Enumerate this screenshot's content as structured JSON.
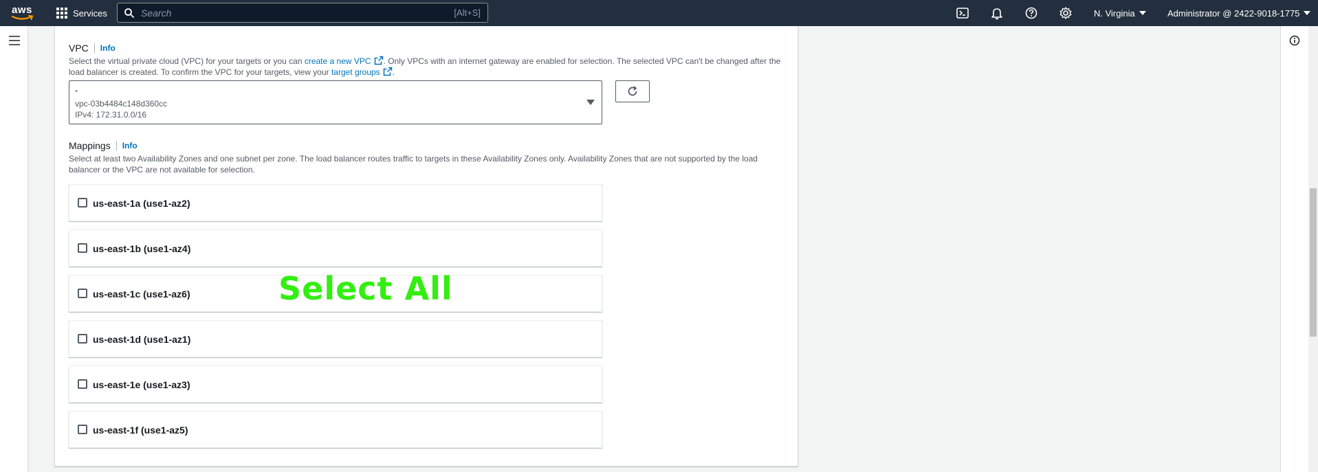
{
  "topnav": {
    "logo_text": "aws",
    "services_label": "Services",
    "search_placeholder": "Search",
    "search_shortcut": "[Alt+S]",
    "region": "N. Virginia",
    "account": "Administrator @ 2422-9018-1775"
  },
  "vpc": {
    "label": "VPC",
    "info": "Info",
    "desc_part1": "Select the virtual private cloud (VPC) for your targets or you can ",
    "desc_link1": "create a new VPC",
    "desc_part2": ". Only VPCs with an internet gateway are enabled for selection. The selected VPC can't be changed after the load balancer is created. To confirm the VPC for your targets, view your ",
    "desc_link2": "target groups",
    "desc_part3": ".",
    "selected_name": "-",
    "selected_id": "vpc-03b4484c148d360cc",
    "selected_cidr": "IPv4: 172.31.0.0/16"
  },
  "mappings": {
    "label": "Mappings",
    "info": "Info",
    "desc": "Select at least two Availability Zones and one subnet per zone. The load balancer routes traffic to targets in these Availability Zones only. Availability Zones that are not supported by the load balancer or the VPC are not available for selection.",
    "zones": [
      {
        "label": "us-east-1a (use1-az2)",
        "checked": false
      },
      {
        "label": "us-east-1b (use1-az4)",
        "checked": false
      },
      {
        "label": "us-east-1c (use1-az6)",
        "checked": false
      },
      {
        "label": "us-east-1d (use1-az1)",
        "checked": false
      },
      {
        "label": "us-east-1e (use1-az3)",
        "checked": false
      },
      {
        "label": "us-east-1f (use1-az5)",
        "checked": false
      }
    ]
  },
  "overlay_text": "Select All",
  "colors": {
    "nav_bg": "#232f3e",
    "link": "#0073bb",
    "overlay": "#33ee11"
  }
}
